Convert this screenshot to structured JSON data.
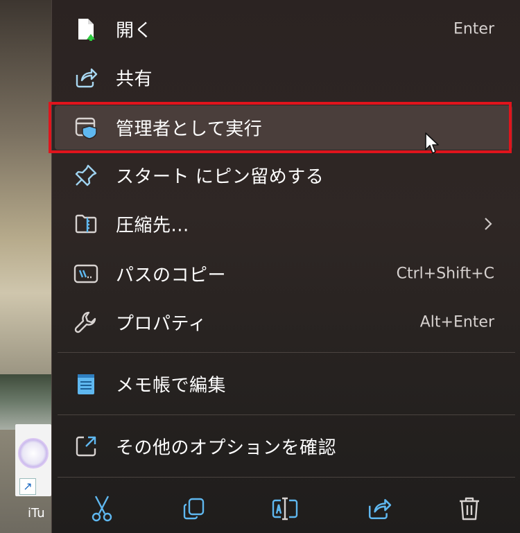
{
  "menu": {
    "items": [
      {
        "label": "開く",
        "shortcut": "Enter",
        "icon": "open-file-icon"
      },
      {
        "label": "共有",
        "shortcut": "",
        "icon": "share-icon"
      },
      {
        "label": "管理者として実行",
        "shortcut": "",
        "icon": "shield-admin-icon",
        "highlighted": true
      },
      {
        "label": "スタート にピン留めする",
        "shortcut": "",
        "icon": "pin-icon"
      },
      {
        "label": "圧縮先...",
        "shortcut": "",
        "icon": "zip-folder-icon",
        "submenu": true
      },
      {
        "label": "パスのコピー",
        "shortcut": "Ctrl+Shift+C",
        "icon": "copy-path-icon"
      },
      {
        "label": "プロパティ",
        "shortcut": "Alt+Enter",
        "icon": "wrench-icon"
      },
      {
        "label": "メモ帳で編集",
        "shortcut": "",
        "icon": "notepad-icon"
      },
      {
        "label": "その他のオプションを確認",
        "shortcut": "",
        "icon": "more-options-icon"
      }
    ],
    "toolbar": [
      {
        "icon": "cut-icon"
      },
      {
        "icon": "copy-icon"
      },
      {
        "icon": "rename-icon"
      },
      {
        "icon": "share-icon"
      },
      {
        "icon": "delete-icon"
      }
    ]
  },
  "desktop": {
    "icon_label": "iTu"
  },
  "colors": {
    "menu_bg": "#2b2322",
    "highlight_border": "#e0141c",
    "accent_blue": "#5fb8f0"
  }
}
